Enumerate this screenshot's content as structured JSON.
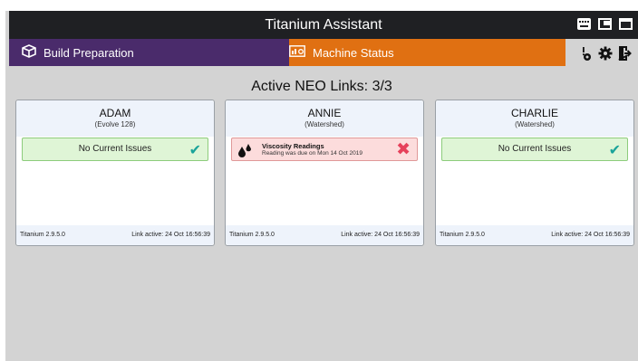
{
  "window": {
    "title": "Titanium Assistant",
    "controls": {
      "keyboard": "keyboard-icon",
      "restore": "restore-window-icon",
      "maximize": "maximize-window-icon"
    }
  },
  "nav": {
    "build_tab": {
      "label": "Build Preparation",
      "icon": "box-icon"
    },
    "machine_tab": {
      "label": "Machine Status",
      "icon": "machine-status-icon"
    },
    "icons": [
      "person-alert-icon",
      "gear-icon",
      "logout-icon"
    ]
  },
  "heading": "Active NEO Links: 3/3",
  "colors": {
    "title_bar": "#1f2023",
    "build_tab": "#4a2b6b",
    "machine_tab": "#e07012",
    "ok_bg": "#dff5d6",
    "ok_check": "#1aa39a",
    "error_bg": "#fcdcdc",
    "error_x": "#e6405a"
  },
  "machines": [
    {
      "name": "ADAM",
      "model": "(Evolve 128)",
      "status": {
        "type": "ok",
        "text": "No Current Issues",
        "icon": "check-icon"
      },
      "version": "Titanium 2.9.5.0",
      "link": "Link active:  24 Oct  16:56:39"
    },
    {
      "name": "ANNIE",
      "model": "(Watershed)",
      "status": {
        "type": "error",
        "title": "Viscosity Readings",
        "detail": "Reading was due on Mon 14 Oct 2019",
        "icon": "droplets-icon"
      },
      "version": "Titanium 2.9.5.0",
      "link": "Link active:  24 Oct  16:56:39"
    },
    {
      "name": "CHARLIE",
      "model": "(Watershed)",
      "status": {
        "type": "ok",
        "text": "No Current Issues",
        "icon": "check-icon"
      },
      "version": "Titanium 2.9.5.0",
      "link": "Link active:  24 Oct  16:56:39"
    }
  ]
}
